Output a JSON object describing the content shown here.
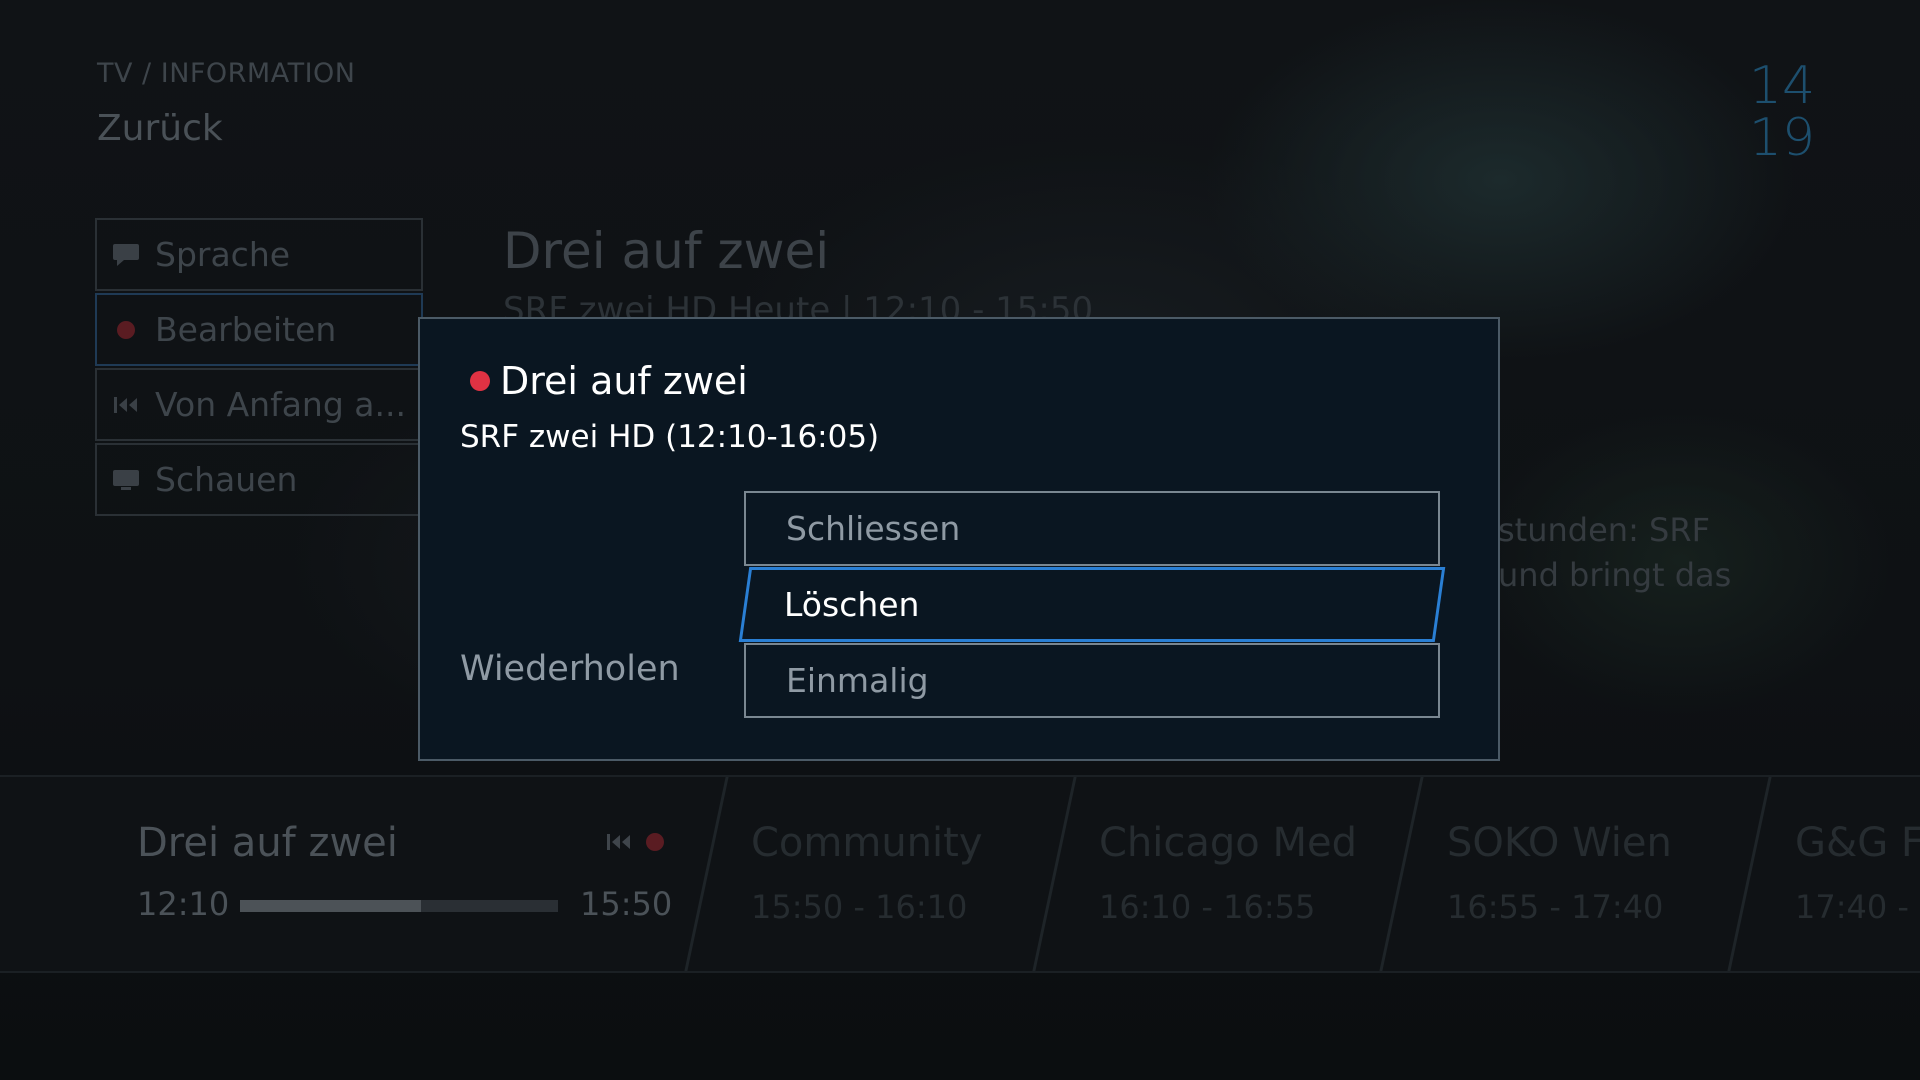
{
  "header": {
    "breadcrumb": "TV / INFORMATION",
    "back_label": "Zurück",
    "clock_hour": "14",
    "clock_minute": "19"
  },
  "side_menu": {
    "items": [
      {
        "label": "Sprache",
        "icon": "speech-bubble-icon"
      },
      {
        "label": "Bearbeiten",
        "icon": "record-dot-icon"
      },
      {
        "label": "Von Anfang a...",
        "icon": "restart-icon"
      },
      {
        "label": "Schauen",
        "icon": "tv-screen-icon"
      }
    ]
  },
  "background_program": {
    "title": "Drei auf zwei",
    "subtitle": "SRF zwei HD  Heute | 12:10 - 15:50",
    "description_line1": "stunden: SRF",
    "description_line2": "und bringt das"
  },
  "dialog": {
    "title": "Drei auf zwei",
    "subtitle": "SRF zwei HD (12:10-16:05)",
    "repeat_label": "Wiederholen",
    "options": [
      "Schliessen",
      "Löschen",
      "Einmalig"
    ],
    "selected_option": "Löschen"
  },
  "epg_strip": {
    "current": {
      "title": "Drei auf zwei",
      "start": "12:10",
      "end": "15:50",
      "progress": 0.57
    },
    "upcoming": [
      {
        "title": "Community",
        "time": "15:50 - 16:10"
      },
      {
        "title": "Chicago Med",
        "time": "16:10 - 16:55"
      },
      {
        "title": "SOKO Wien",
        "time": "16:55 - 17:40"
      },
      {
        "title": "G&G F",
        "time": "17:40 -"
      }
    ]
  },
  "colors": {
    "accent_blue": "#2a7fd4",
    "record_red": "#e03243",
    "dialog_bg": "#0a1621"
  }
}
